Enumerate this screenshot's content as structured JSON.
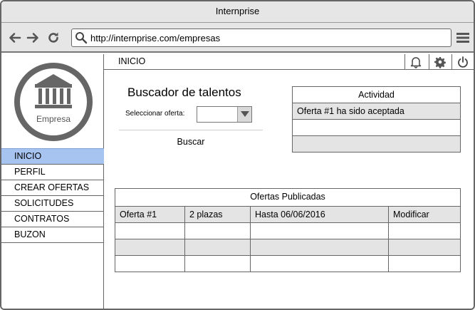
{
  "window": {
    "title": "Internprise"
  },
  "browser": {
    "url": "http://internprise.com/empresas",
    "icons": [
      "back-arrow-icon",
      "forward-arrow-icon",
      "refresh-icon",
      "search-icon",
      "hamburger-menu-icon"
    ]
  },
  "sidebar": {
    "logo_label": "Empresa",
    "items": [
      {
        "label": "INICIO",
        "active": true
      },
      {
        "label": "PERFIL"
      },
      {
        "label": "CREAR OFERTAS"
      },
      {
        "label": "SOLICITUDES"
      },
      {
        "label": "CONTRATOS"
      },
      {
        "label": "BUZON"
      }
    ],
    "colors": {
      "active_bg": "#a7c3ef"
    }
  },
  "header": {
    "title": "INICIO",
    "icons": [
      "bell-icon",
      "gear-icon",
      "power-icon"
    ]
  },
  "search": {
    "title": "Buscador de talentos",
    "select_label": "Seleccionar oferta:",
    "select_value": "",
    "button_label": "Buscar"
  },
  "activity": {
    "title": "Actividad",
    "rows": [
      "Oferta #1 ha sido aceptada",
      "",
      ""
    ]
  },
  "offers": {
    "title": "Ofertas Publicadas",
    "rows": [
      [
        "Oferta #1",
        "2 plazas",
        "Hasta 06/06/2016",
        "Modificar"
      ],
      [
        "",
        "",
        "",
        ""
      ],
      [
        "",
        "",
        "",
        ""
      ],
      [
        "",
        "",
        "",
        ""
      ]
    ]
  }
}
